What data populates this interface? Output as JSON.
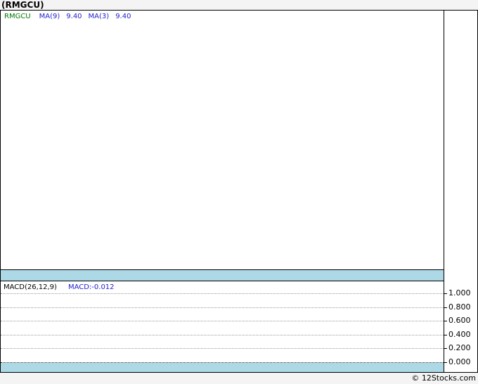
{
  "page": {
    "title": "(RMGCU)",
    "copyright": "© 12Stocks.com"
  },
  "colors": {
    "page_background": "#f4f4f4",
    "panel_background": "#ffffff",
    "border": "#000000",
    "band_blue": "#add8e6",
    "symbol_green": "#007700",
    "indicator_blue": "#2222cc",
    "gridline_gray": "#9a9a9a"
  },
  "main_chart": {
    "legend": {
      "symbol": "RMGCU",
      "ma1_label": "MA(9)",
      "ma1_value": "9.40",
      "ma2_label": "MA(3)",
      "ma2_value": "9.40"
    }
  },
  "macd_chart": {
    "label": "MACD(26,12,9)",
    "value_label": "MACD:-0.012",
    "axis_ticks": [
      "1.000",
      "0.800",
      "0.600",
      "0.400",
      "0.200",
      "0.000"
    ]
  },
  "chart_data": [
    {
      "type": "line",
      "title": "(RMGCU)",
      "series": [
        {
          "name": "RMGCU",
          "values": []
        },
        {
          "name": "MA(9)",
          "last_value": 9.4,
          "values": []
        },
        {
          "name": "MA(3)",
          "last_value": 9.4,
          "values": []
        }
      ],
      "xlabel": "",
      "ylabel": "",
      "grid": false,
      "legend_position": "top-left",
      "note": "price panel is empty — no plotted data visible"
    },
    {
      "type": "line",
      "title": "MACD(26,12,9)",
      "series": [
        {
          "name": "MACD",
          "last_value": -0.012,
          "values": []
        }
      ],
      "ylim": [
        0.0,
        1.0
      ],
      "yticks": [
        1.0,
        0.8,
        0.6,
        0.4,
        0.2,
        0.0
      ],
      "grid": true,
      "gridline_style": "dotted",
      "legend_position": "top-left",
      "note": "indicator panel is empty — no plotted data visible"
    }
  ]
}
